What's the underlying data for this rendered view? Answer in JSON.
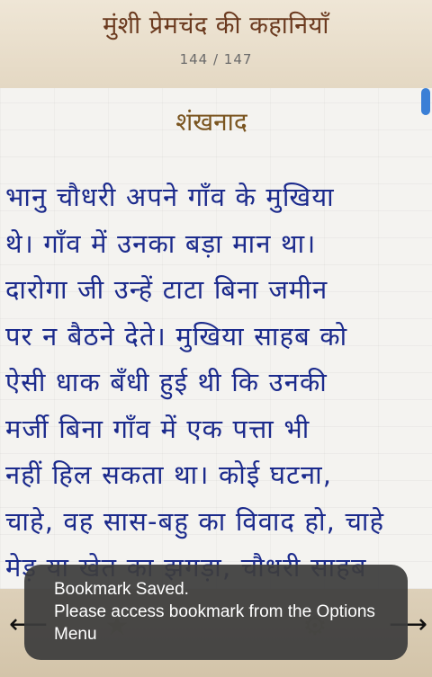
{
  "header": {
    "book_title": "मुंशी प्रेमचंद की कहानियाँ",
    "page_counter": "144 / 147"
  },
  "story": {
    "title": "शंखनाद",
    "lines": [
      "भानु चौधरी अपने गाँव के मुखिया",
      "थे। गाँव में उनका बड़ा मान था।",
      "दारोगा जी उन्हें टाटा बिना जमीन",
      "पर न बैठने देते। मुखिया साहब को",
      "ऐसी धाक बँधी हुई थी कि उनकी",
      "मर्जी बिना गाँव में एक पत्ता भी",
      "नहीं हिल सकता था। कोई घटना,",
      "चाहे, वह सास-बहु का विवाद हो, चाहे",
      "मेड़ या खेत का झगड़ा, चौधरी साहब"
    ]
  },
  "footer": {
    "prev_icon": "arrow-left",
    "bookmark_icon": "star",
    "settings_icon": "gear",
    "next_icon": "arrow-right"
  },
  "toast": {
    "line1": "Bookmark Saved.",
    "line2": "Please access bookmark from the Options",
    "line3": "Menu"
  }
}
